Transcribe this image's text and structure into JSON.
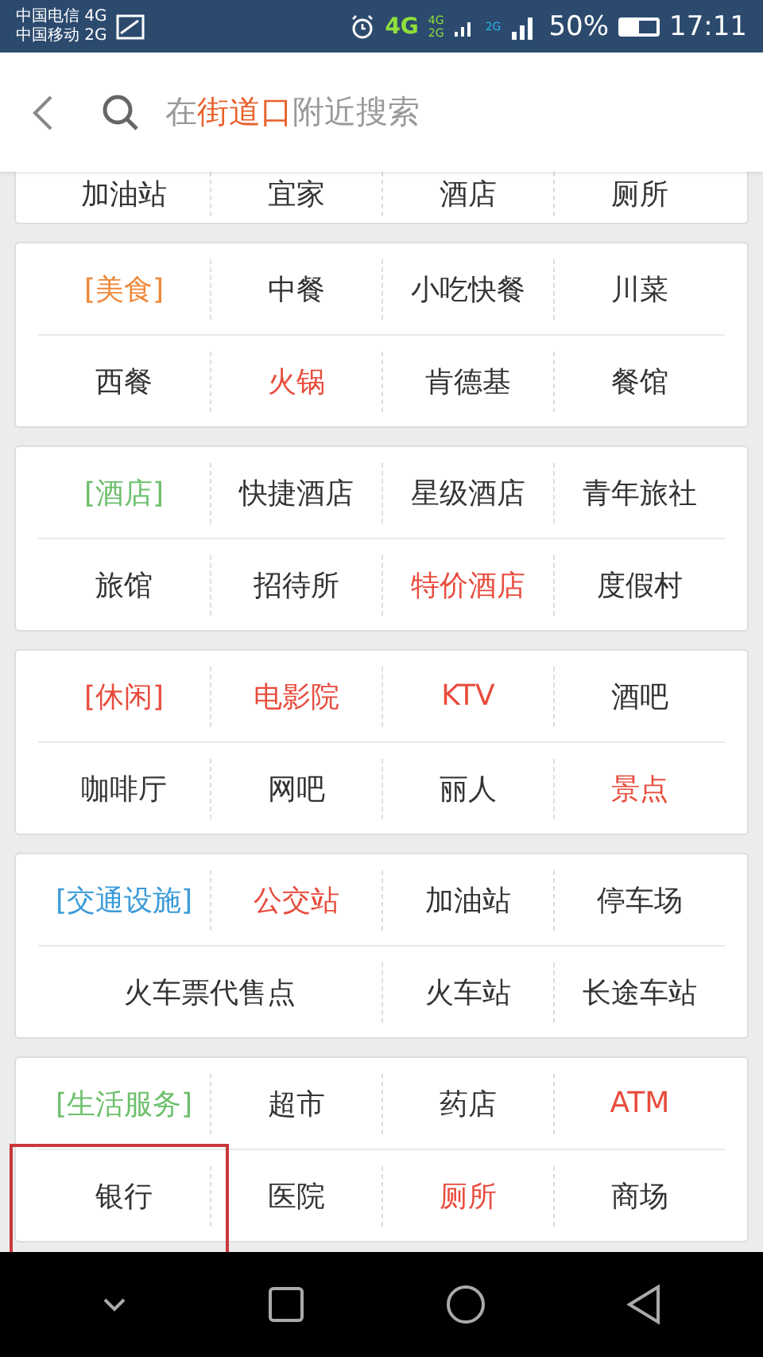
{
  "status_bar": {
    "carriers": [
      "中国电信 4G",
      "中国移动 2G"
    ],
    "network": "4G",
    "sim1_labels": [
      "4G",
      "2G"
    ],
    "sim2_label": "2G",
    "battery_text": "50%",
    "time": "17:11"
  },
  "search": {
    "placeholder": [
      {
        "text": "在",
        "accent": false
      },
      {
        "text": "街道口",
        "accent": true
      },
      {
        "text": "附近搜索",
        "accent": false
      }
    ]
  },
  "partial_row": [
    "加油站",
    "宜家",
    "酒店",
    "厕所"
  ],
  "sections": [
    {
      "rows": [
        [
          {
            "kind": "category",
            "label": "[美食]",
            "color": "#f0883a"
          },
          {
            "kind": "item",
            "label": "中餐",
            "hot": false
          },
          {
            "kind": "item",
            "label": "小吃快餐",
            "hot": false
          },
          {
            "kind": "item",
            "label": "川菜",
            "hot": false
          }
        ],
        [
          {
            "kind": "item",
            "label": "西餐",
            "hot": false
          },
          {
            "kind": "item",
            "label": "火锅",
            "hot": true
          },
          {
            "kind": "item",
            "label": "肯德基",
            "hot": false
          },
          {
            "kind": "item",
            "label": "餐馆",
            "hot": false
          }
        ]
      ]
    },
    {
      "rows": [
        [
          {
            "kind": "category",
            "label": "[酒店]",
            "color": "#6cbf6c"
          },
          {
            "kind": "item",
            "label": "快捷酒店",
            "hot": false
          },
          {
            "kind": "item",
            "label": "星级酒店",
            "hot": false
          },
          {
            "kind": "item",
            "label": "青年旅社",
            "hot": false
          }
        ],
        [
          {
            "kind": "item",
            "label": "旅馆",
            "hot": false
          },
          {
            "kind": "item",
            "label": "招待所",
            "hot": false
          },
          {
            "kind": "item",
            "label": "特价酒店",
            "hot": true
          },
          {
            "kind": "item",
            "label": "度假村",
            "hot": false
          }
        ]
      ]
    },
    {
      "rows": [
        [
          {
            "kind": "category",
            "label": "[休闲]",
            "color": "#e84c3d"
          },
          {
            "kind": "item",
            "label": "电影院",
            "hot": true
          },
          {
            "kind": "item",
            "label": "KTV",
            "hot": true
          },
          {
            "kind": "item",
            "label": "酒吧",
            "hot": false
          }
        ],
        [
          {
            "kind": "item",
            "label": "咖啡厅",
            "hot": false
          },
          {
            "kind": "item",
            "label": "网吧",
            "hot": false
          },
          {
            "kind": "item",
            "label": "丽人",
            "hot": false
          },
          {
            "kind": "item",
            "label": "景点",
            "hot": true
          }
        ]
      ]
    },
    {
      "rows": [
        [
          {
            "kind": "category",
            "label": "[交通设施]",
            "color": "#3a9ad9"
          },
          {
            "kind": "item",
            "label": "公交站",
            "hot": true
          },
          {
            "kind": "item",
            "label": "加油站",
            "hot": false
          },
          {
            "kind": "item",
            "label": "停车场",
            "hot": false
          }
        ],
        [
          {
            "kind": "item",
            "label": "火车票代售点",
            "hot": false
          },
          {
            "kind": "merged"
          },
          {
            "kind": "item",
            "label": "火车站",
            "hot": false
          },
          {
            "kind": "item",
            "label": "长途车站",
            "hot": false
          }
        ]
      ]
    },
    {
      "rows": [
        [
          {
            "kind": "category",
            "label": "[生活服务]",
            "color": "#6cbf6c"
          },
          {
            "kind": "item",
            "label": "超市",
            "hot": false
          },
          {
            "kind": "item",
            "label": "药店",
            "hot": false
          },
          {
            "kind": "item",
            "label": "ATM",
            "hot": true
          }
        ],
        [
          {
            "kind": "item",
            "label": "银行",
            "hot": false,
            "highlighted": true
          },
          {
            "kind": "item",
            "label": "医院",
            "hot": false
          },
          {
            "kind": "item",
            "label": "厕所",
            "hot": true
          },
          {
            "kind": "item",
            "label": "商场",
            "hot": false
          }
        ]
      ]
    }
  ]
}
